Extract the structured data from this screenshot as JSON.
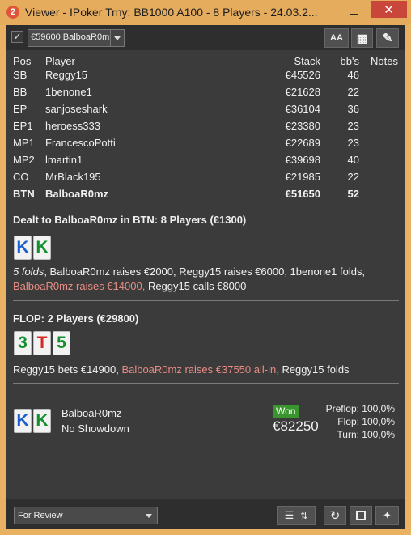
{
  "window": {
    "title": "Viewer - IPoker Trny: BB1000 A100 - 8 Players - 24.03.2...",
    "app_badge": "2",
    "close_symbol": "✕"
  },
  "toolbar": {
    "checkbox_mark": "✓",
    "hand_selector": "€59600 BalboaR0m",
    "font_button": "AA",
    "grid_button": "▦",
    "edit_button": "✎"
  },
  "players_table": {
    "headers": {
      "pos": "Pos",
      "player": "Player",
      "stack": "Stack",
      "bbs": "bb's",
      "notes": "Notes"
    },
    "rows": [
      {
        "pos": "SB",
        "player": "Reggy15",
        "stack": "€45526",
        "bbs": "46"
      },
      {
        "pos": "BB",
        "player": "1benone1",
        "stack": "€21628",
        "bbs": "22"
      },
      {
        "pos": "EP",
        "player": "sanjoseshark",
        "stack": "€36104",
        "bbs": "36"
      },
      {
        "pos": "EP1",
        "player": "heroess333",
        "stack": "€23380",
        "bbs": "23"
      },
      {
        "pos": "MP1",
        "player": "FrancescoPotti",
        "stack": "€22689",
        "bbs": "23"
      },
      {
        "pos": "MP2",
        "player": "lmartin1",
        "stack": "€39698",
        "bbs": "40"
      },
      {
        "pos": "CO",
        "player": "MrBlack195",
        "stack": "€21985",
        "bbs": "22"
      },
      {
        "pos": "BTN",
        "player": "BalboaR0mz",
        "stack": "€51650",
        "bbs": "52"
      }
    ]
  },
  "preflop": {
    "title": "Dealt to BalboaR0mz in BTN: 8 Players (€1300)",
    "hole_cards": [
      "K",
      "K"
    ],
    "action_folds": "5 folds",
    "action_a": ", BalboaR0mz raises €2000, Reggy15 raises €6000, 1benone1 folds,",
    "action_hero": "BalboaR0mz raises €14000,",
    "action_b": " Reggy15 calls €8000"
  },
  "flop": {
    "title": "FLOP: 2 Players (€29800)",
    "board": [
      "3",
      "T",
      "5"
    ],
    "action_a": "Reggy15 bets €14900, ",
    "action_hero": "BalboaR0mz raises €37550 all-in,",
    "action_b": " Reggy15 folds"
  },
  "result": {
    "cards": [
      "K",
      "K"
    ],
    "player": "BalboaR0mz",
    "showdown": "No Showdown",
    "badge": "Won",
    "amount": "€82250",
    "equity_preflop": "Preflop: 100,0%",
    "equity_flop": "Flop: 100,0%",
    "equity_turn": "Turn: 100,0%"
  },
  "bottom": {
    "review_status": "For Review",
    "notes_icon": "☰",
    "updown_icon": "⇅",
    "replay_icon": "↻",
    "save_icon": "▪",
    "twitter_icon": "✦"
  },
  "colors": {
    "background": "#3b3b3b",
    "title_bar": "#e6ac5e",
    "highlight_action": "#e88c84",
    "won_badge": "#39952d",
    "card_blue": "#1b5fcf",
    "card_green": "#12912e",
    "card_red": "#d42a24"
  }
}
